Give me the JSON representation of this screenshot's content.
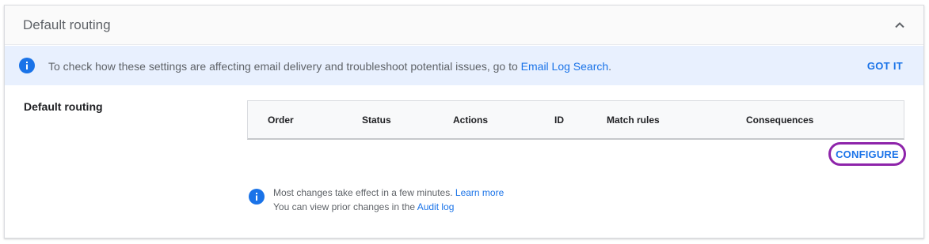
{
  "card": {
    "title": "Default routing"
  },
  "banner": {
    "text": "To check how these settings are affecting email delivery and troubleshoot potential issues, go to ",
    "link": "Email Log Search",
    "suffix": ".",
    "dismiss_label": "GOT IT"
  },
  "section": {
    "label": "Default routing"
  },
  "table": {
    "columns": [
      "Order",
      "Status",
      "Actions",
      "ID",
      "Match rules",
      "Consequences"
    ],
    "rows": []
  },
  "configure_label": "CONFIGURE",
  "footer": {
    "line1_text": "Most changes take effect in a few minutes. ",
    "line1_link": "Learn more",
    "line2_text": "You can view prior changes in the ",
    "line2_link": "Audit log"
  },
  "colors": {
    "accent": "#1a73e8",
    "banner_bg": "#e8f0fe",
    "highlight_ring": "#8e24aa"
  }
}
